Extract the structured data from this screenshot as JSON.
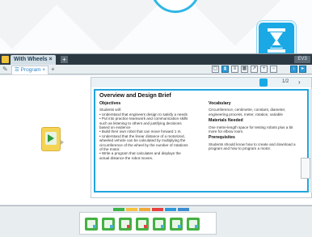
{
  "project": {
    "tab_label": "With Wheels",
    "tab_close": "×",
    "add_tab": "+",
    "right_label": "EV3"
  },
  "program": {
    "tab_label": "Program",
    "tab_close": "×",
    "add_tab": "+"
  },
  "editor": {
    "page_indicator": "1/2",
    "next_arrow": "›",
    "title": "Overview and Design Brief",
    "objectives": {
      "heading": "Objectives",
      "lines": [
        "Students will:",
        "• Understand that engineers design to satisfy a needs",
        "• Put into practice teamwork and communication skills",
        "such as listening to others and justifying decisions",
        "based on evidence",
        "• Build their own robot that can move forward 1 m.",
        "• Understand that the linear distance of a motorized,",
        "wheeled vehicle can be calculated by multiplying the",
        "circumference of the wheel by the number of rotations",
        "of the motor.",
        "• Write a program that calculates and displays the",
        "actual distance the robot moves."
      ]
    },
    "vocabulary": {
      "heading": "Vocabulary",
      "lines": [
        "Circumference, centimetre, constant, diameter,",
        "engineering process, meter, rotation, variable"
      ]
    },
    "materials": {
      "heading": "Materials Needed",
      "lines": [
        "One metre-length space for testing robots plus a bit",
        "more for elbow room."
      ]
    },
    "prerequisites": {
      "heading": "Prerequisites",
      "lines": [
        "Students should know how to create and download a",
        "program and how to program a motor."
      ]
    }
  },
  "toolbar": {
    "icons": [
      "tag-icon",
      "content-editor-icon",
      "list-icon",
      "table-icon",
      "chart-icon",
      "zoom-in-icon",
      "zoom-out-icon"
    ]
  },
  "palette": {
    "tab_colors": [
      "#3cb44a",
      "#f5c242",
      "#f2a93b",
      "#e83f3f",
      "#2c9ad8",
      "#3b8dd1"
    ],
    "blocks": [
      "large-motor-block",
      "medium-motor-block",
      "move-steering-block",
      "move-tank-block",
      "display-block",
      "sound-block",
      "brick-status-light-block"
    ],
    "block_accents": [
      "#4bb0d6",
      "#4bb0d6",
      "#e04545",
      "#e04545",
      "#4bb0d6",
      "#4bb0d6",
      "#4bb0d6"
    ]
  },
  "colors": {
    "accent": "#1aa9e5",
    "start_block": "#f5d455",
    "action_block": "#45b043"
  }
}
